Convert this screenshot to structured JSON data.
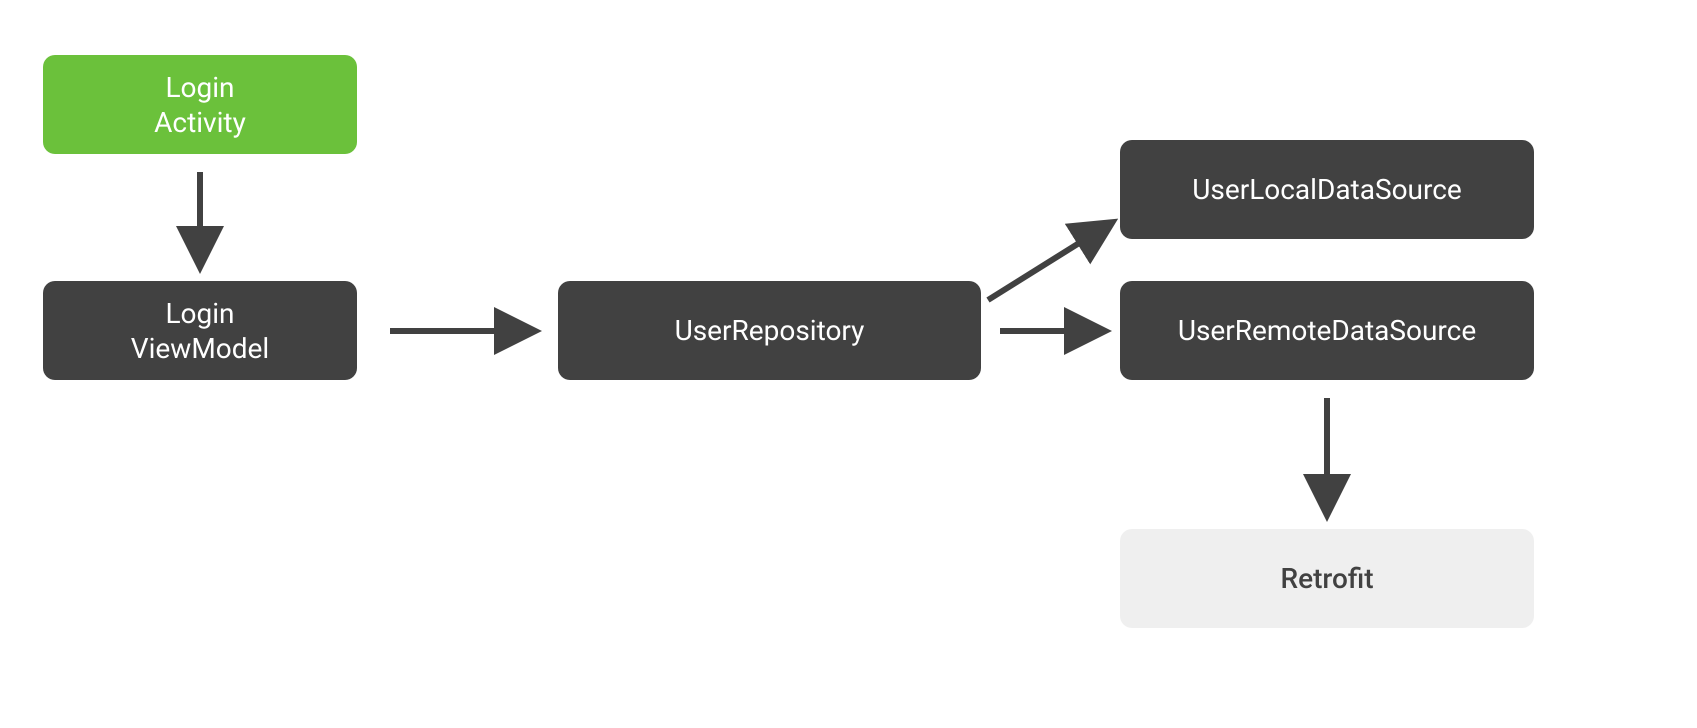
{
  "nodes": {
    "login_activity": {
      "label": "Login\nActivity"
    },
    "login_viewmodel": {
      "label": "Login\nViewModel"
    },
    "user_repository": {
      "label": "UserRepository"
    },
    "user_local_ds": {
      "label": "UserLocalDataSource"
    },
    "user_remote_ds": {
      "label": "UserRemoteDataSource"
    },
    "retrofit": {
      "label": "Retrofit"
    }
  },
  "colors": {
    "green": "#6BC13B",
    "dark": "#414141",
    "light": "#EFEFEF",
    "arrow": "#414141"
  }
}
